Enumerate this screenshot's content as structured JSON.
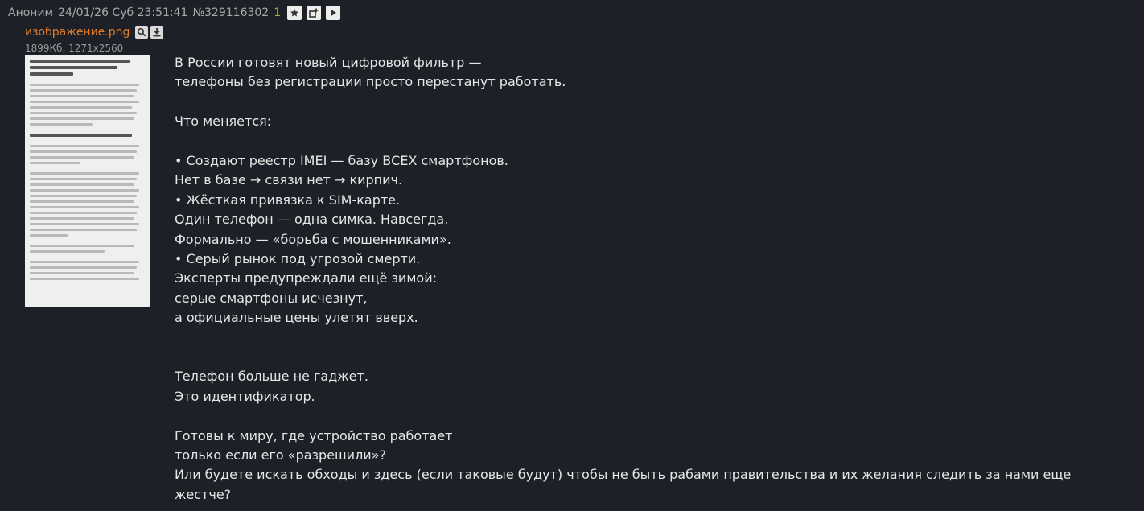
{
  "header": {
    "name": "Аноним",
    "datetime": "24/01/26 Суб 23:51:41",
    "post_number": "№329116302",
    "reply_count": "1"
  },
  "file": {
    "name": "изображение.png",
    "meta": "1899Кб, 1271x2560"
  },
  "message": {
    "lines": [
      "В России готовят новый цифровой фильтр —",
      "телефоны без регистрации просто перестанут работать.",
      "",
      "Что меняется:",
      "",
      "• Создают реестр IMEI — базу ВСЕХ смартфонов.",
      "Нет в базе → связи нет → кирпич.",
      "• Жёсткая привязка к SIM-карте.",
      "Один телефон — одна симка. Навсегда.",
      "Формально — «борьба с мошенниками».",
      "• Серый рынок под угрозой смерти.",
      "Эксперты предупреждали ещё зимой:",
      "серые смартфоны исчезнут,",
      "а официальные цены улетят вверх.",
      "",
      "",
      "Телефон больше не гаджет.",
      "Это идентификатор.",
      "",
      "Готовы к миру, где устройство работает",
      "только если его «разрешили»?",
      "Или будете искать обходы и здесь (если таковые будут) чтобы не быть рабами правительства и их желания следить за нами еще жестче?"
    ]
  }
}
